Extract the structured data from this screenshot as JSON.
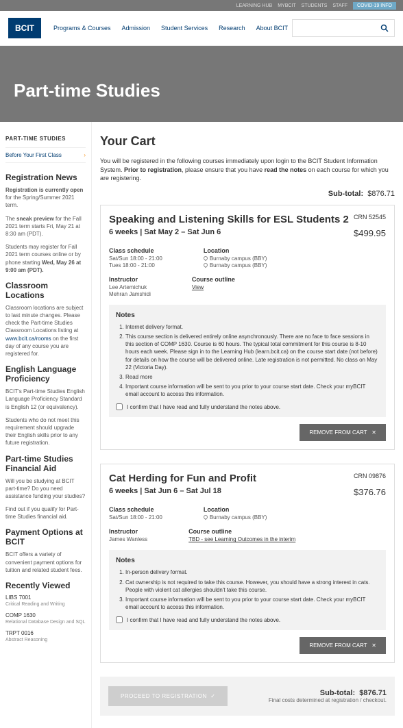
{
  "topbar": [
    "LEARNING HUB",
    "MYBCIT",
    "STUDENTS",
    "STAFF",
    "COVID-19 INFO"
  ],
  "logo": "BCIT",
  "nav": [
    "Programs & Courses",
    "Admission",
    "Student Services",
    "Research",
    "About BCIT"
  ],
  "hero": "Part-time Studies",
  "sidebar": {
    "title": "PART-TIME STUDIES",
    "before": "Before Your First Class",
    "news_h": "Registration News",
    "news1": "Registration is currently open for the Spring/Summer 2021 term.",
    "news2": "The sneak preview for the Fall 2021 term starts Fri, May 21 at 8:30 am (PDT).",
    "news3": "Students may register for Fall 2021 term courses online or by phone starting Wed, May 26 at 9:00 am (PDT).",
    "loc_h": "Classroom Locations",
    "loc1": "Classroom locations are subject to last minute changes. Please check the Part-time Studies Classroom Locations listing at",
    "loc_link": "www.bcit.ca/rooms",
    "loc2": "on the first day of any course you are registered for.",
    "elp_h": "English Language Proficiency",
    "elp1": "BCIT's Part-time Studies English Language Proficiency Standard is English 12 (or equivalency).",
    "elp2": "Students who do not meet this requirement should upgrade their English skills prior to any future registration.",
    "fa_h": "Part-time Studies Financial Aid",
    "fa1": "Will you be studying at BCIT part-time? Do you need assistance funding your studies?",
    "fa2": "Find out if you qualify for Part-time Studies financial aid.",
    "pay_h": "Payment Options at BCIT",
    "pay1": "BCIT offers a variety of convenient payment options for tuition and related student fees.",
    "rv_h": "Recently Viewed",
    "rv": [
      {
        "c": "LIBS 7001",
        "t": "Critical Reading and Writing"
      },
      {
        "c": "COMP 1630",
        "t": "Relational Database Design and SQL"
      },
      {
        "c": "TRPT 0016",
        "t": "Abstract Reasoning"
      }
    ]
  },
  "cart": {
    "title": "Your Cart",
    "intro": "You will be registered in the following courses immediately upon login to the BCIT Student Information System. Prior to registration, please ensure that you have read the notes on each course for which you are registering.",
    "subtotal_label": "Sub-total:",
    "subtotal": "$876.71",
    "final": "Final costs determined at registration / checkout.",
    "proceed": "PROCEED TO REGISTRATION",
    "remove": "REMOVE FROM CART",
    "confirm": "I confirm that I have read and fully understand the notes above.",
    "courses": [
      {
        "title": "Speaking and Listening Skills for ESL Students 2",
        "crn": "CRN 52545",
        "weeks": "6 weeks  |  Sat May 2 – Sat Jun 6",
        "price": "$499.95",
        "sched_h": "Class schedule",
        "sched": [
          "Sat/Sun  18:00 - 21:00",
          "Tues      18:00 - 21:00"
        ],
        "loc_h": "Location",
        "loc": [
          "Burnaby campus (BBY)",
          "Burnaby campus (BBY)"
        ],
        "inst_h": "Instructor",
        "inst": [
          "Lee Artemichuk",
          "Mehran Jamshidi"
        ],
        "out_h": "Course outline",
        "out": "View",
        "notes_h": "Notes",
        "notes": [
          "Internet delivery format.",
          "This course section is delivered entirely online asynchronously. There are no face to face sessions in this section of COMP 1630. Course is 60 hours. The typical total commitment for this course is 8-10 hours each week. Please sign in to the Learning Hub (learn.bcit.ca) on the course start date (not before) for details on how the course will be delivered online. Late registration is not permitted. No class on May 22 (Victoria Day).",
          "Read more",
          "Important course information will be sent to you prior to your course start date. Check your myBCIT email account to access this information."
        ]
      },
      {
        "title": "Cat Herding for Fun and Profit",
        "crn": "CRN 09876",
        "weeks": "6 weeks  |  Sat Jun 6 – Sat Jul 18",
        "price": "$376.76",
        "sched_h": "Class schedule",
        "sched": [
          "Sat/Sun  18:00 - 21:00"
        ],
        "loc_h": "Location",
        "loc": [
          "Burnaby campus (BBY)"
        ],
        "inst_h": "Instructor",
        "inst": [
          "James Wanless"
        ],
        "out_h": "Course outline",
        "out": "TBD - see Learning Outcomes in the interim",
        "notes_h": "Notes",
        "notes": [
          "In-person delivery format.",
          "Cat ownership is not required to take this course. However, you should have a strong interest in cats. People with violent cat allergies shouldn't take this course.",
          "Important course information will be sent to you prior to your course start date. Check your myBCIT email account to access this information."
        ]
      }
    ]
  }
}
